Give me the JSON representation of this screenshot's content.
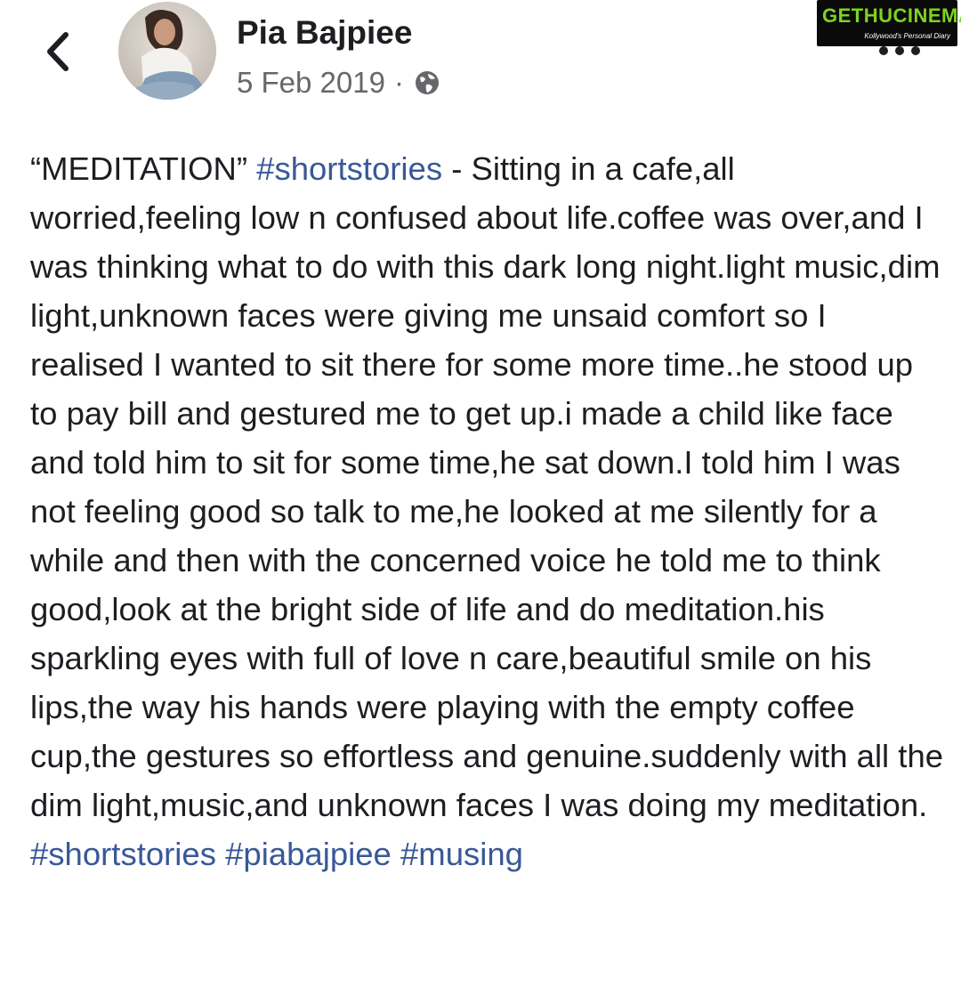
{
  "post": {
    "author": "Pia Bajpiee",
    "date": "5 Feb 2019",
    "separator": "·",
    "privacy_icon": "globe-icon",
    "text": {
      "opening_quote": "“MEDITATION”",
      "first_hashtag": "#shortstories",
      "body": " - Sitting in a cafe,all worried,feeling low n confused about life.coffee was over,and I was thinking what to do with this dark long night.light music,dim light,unknown faces were giving me unsaid comfort so I realised I wanted to sit there for some more time..he stood up to pay bill and gestured me to get up.i made a child like face and told him to sit for some time,he sat down.I told him I was not feeling good so talk to me,he looked at me silently for a while and then with the concerned voice he told me to think good,look at the bright side of life and do meditation.his sparkling eyes with full of love n care,beautiful smile on his lips,the way his hands were playing with the empty coffee cup,the gestures so effortless and genuine.suddenly with all the dim light,music,and unknown faces I was doing my meditation. ",
      "end_hashtags": [
        "#shortstories",
        "#piabajpiee",
        "#musing"
      ]
    }
  },
  "watermark": {
    "name": "GETHUCINEMA",
    "tagline": "Kollywood's Personal Diary"
  },
  "icons": {
    "back": "chevron-left-icon",
    "more": "more-options-icon",
    "privacy": "globe-icon"
  },
  "colors": {
    "hashtag": "#385898",
    "text": "#1c1e21",
    "meta": "#65676b",
    "watermark_green": "#7ed321"
  }
}
